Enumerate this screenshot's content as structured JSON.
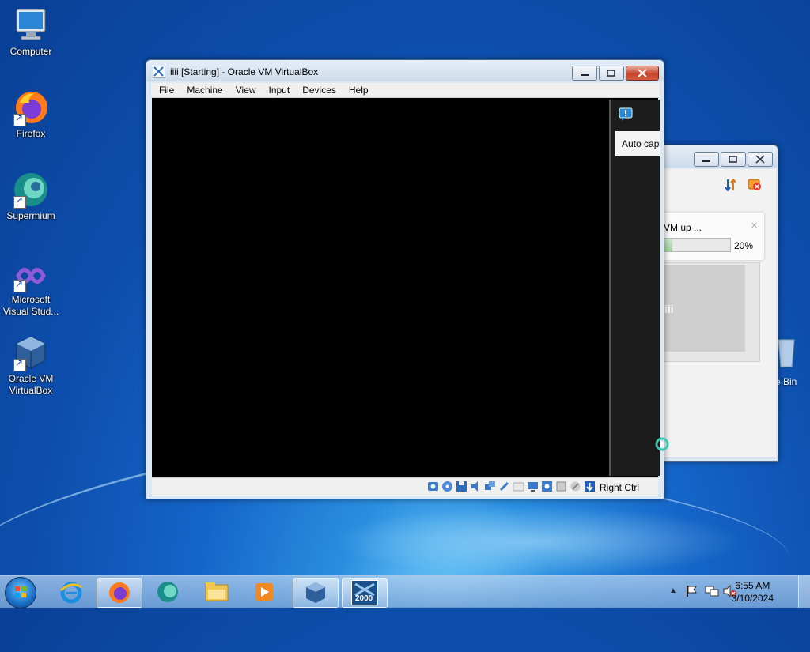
{
  "desktop": {
    "icons": [
      {
        "label": "Computer"
      },
      {
        "label": "Firefox"
      },
      {
        "label": "Supermium"
      },
      {
        "label": "Microsoft Visual Stud..."
      },
      {
        "label": "Oracle VM VirtualBox"
      }
    ],
    "recycle_bin_label": "e Bin"
  },
  "vm_window": {
    "title": "iiii [Starting] - Oracle VM VirtualBox",
    "menu": [
      "File",
      "Machine",
      "View",
      "Input",
      "Devices",
      "Help"
    ],
    "notification_text": "Auto capt",
    "host_key": "Right Ctrl"
  },
  "manager_window": {
    "progress_text": "VM up ...",
    "progress_percent": "20%",
    "progress_fraction": 0.2,
    "vm_preview_name": "iiii"
  },
  "taskbar": {
    "pinned": [
      "internet-explorer-icon",
      "firefox-icon",
      "supermium-icon",
      "explorer-icon",
      "media-player-icon",
      "virtualbox-icon",
      "vm-2000-icon"
    ],
    "vm_badge": "2000",
    "time": "6:55 AM",
    "date": "3/10/2024"
  },
  "colors": {
    "vm_screen": "#000000",
    "accent": "#1b6fc4"
  }
}
